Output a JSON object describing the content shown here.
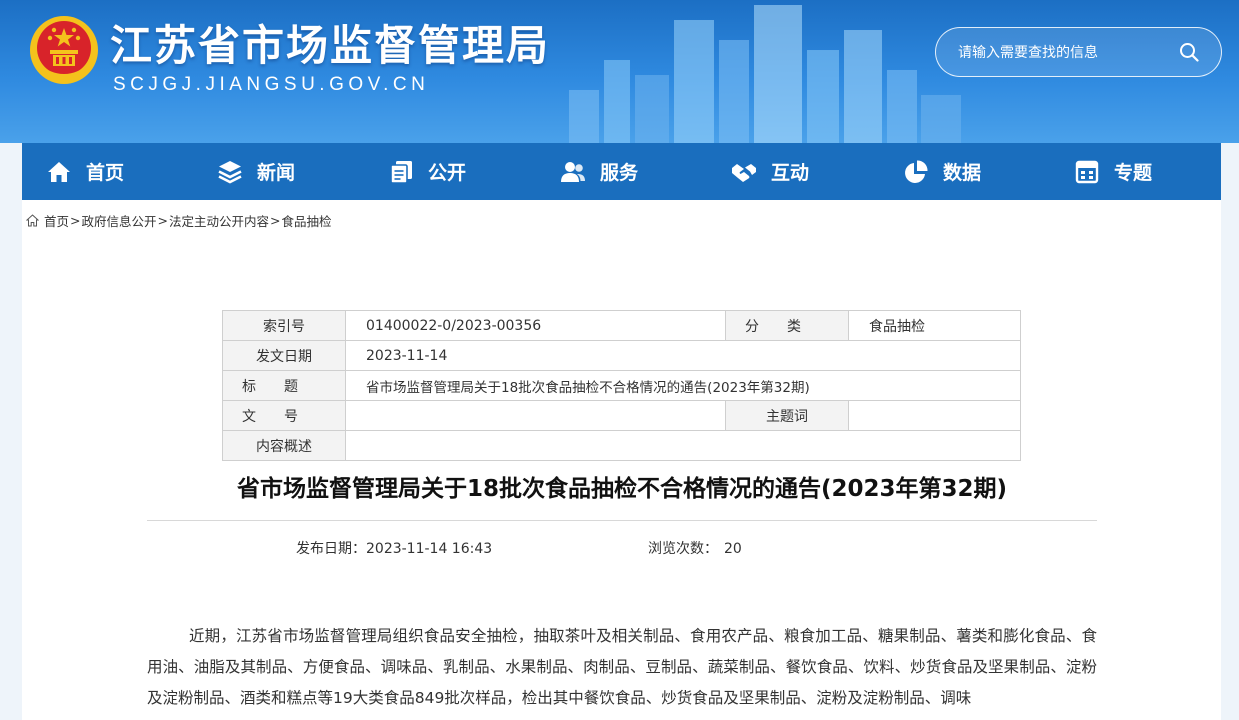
{
  "site": {
    "title": "江苏省市场监督管理局",
    "domain": "SCJGJ.JIANGSU.GOV.CN",
    "search_placeholder": "请输入需要查找的信息"
  },
  "nav": {
    "items": [
      {
        "label": "首页",
        "icon": "home-icon"
      },
      {
        "label": "新闻",
        "icon": "layers-icon"
      },
      {
        "label": "公开",
        "icon": "files-icon"
      },
      {
        "label": "服务",
        "icon": "users-icon"
      },
      {
        "label": "互动",
        "icon": "handshake-icon"
      },
      {
        "label": "数据",
        "icon": "pie-chart-icon"
      },
      {
        "label": "专题",
        "icon": "calendar-icon"
      }
    ]
  },
  "breadcrumb": [
    "首页",
    "政府信息公开",
    "法定主动公开内容",
    "食品抽检"
  ],
  "meta": {
    "index_label": "索引号",
    "index_value": "01400022-0/2023-00356",
    "category_label": "分类",
    "category_value": "食品抽检",
    "date_label": "发文日期",
    "date_value": "2023-11-14",
    "title_label": "标题",
    "title_value": "省市场监督管理局关于18批次食品抽检不合格情况的通告(2023年第32期)",
    "docno_label": "文号",
    "docno_value": "",
    "keyword_label": "主题词",
    "keyword_value": "",
    "summary_label": "内容概述",
    "summary_value": ""
  },
  "article": {
    "title": "省市场监督管理局关于18批次食品抽检不合格情况的通告(2023年第32期)",
    "publish_label": "发布日期：",
    "publish_value": "2023-11-14 16:43",
    "views_label": "浏览次数：",
    "views_value": "20",
    "paragraph": "近期，江苏省市场监督管理局组织食品安全抽检，抽取茶叶及相关制品、食用农产品、粮食加工品、糖果制品、薯类和膨化食品、食用油、油脂及其制品、方便食品、调味品、乳制品、水果制品、肉制品、豆制品、蔬菜制品、餐饮食品、饮料、炒货食品及坚果制品、淀粉及淀粉制品、酒类和糕点等19大类食品849批次样品，检出其中餐饮食品、炒货食品及坚果制品、淀粉及淀粉制品、调味"
  },
  "colors": {
    "nav_bg": "#1a6ebe",
    "header_top": "#1c6fc4",
    "header_bottom": "#4aa1ea"
  }
}
